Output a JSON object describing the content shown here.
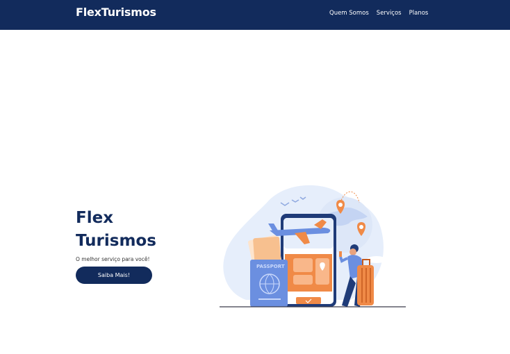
{
  "navbar": {
    "brand": "FlexTurismos",
    "links": [
      "Quem Somos",
      "Serviços",
      "Planos"
    ]
  },
  "hero": {
    "title_line1": "Flex",
    "title_line2": "Turismos",
    "subtitle": "O melhor serviço para você!",
    "button_label": "Saiba Mais!",
    "illustration": {
      "passport_label": "PASSPORT"
    }
  },
  "colors": {
    "navbar": "#122b5c",
    "accent": "#f08a47",
    "illustration_blue": "#6b8fe0"
  }
}
